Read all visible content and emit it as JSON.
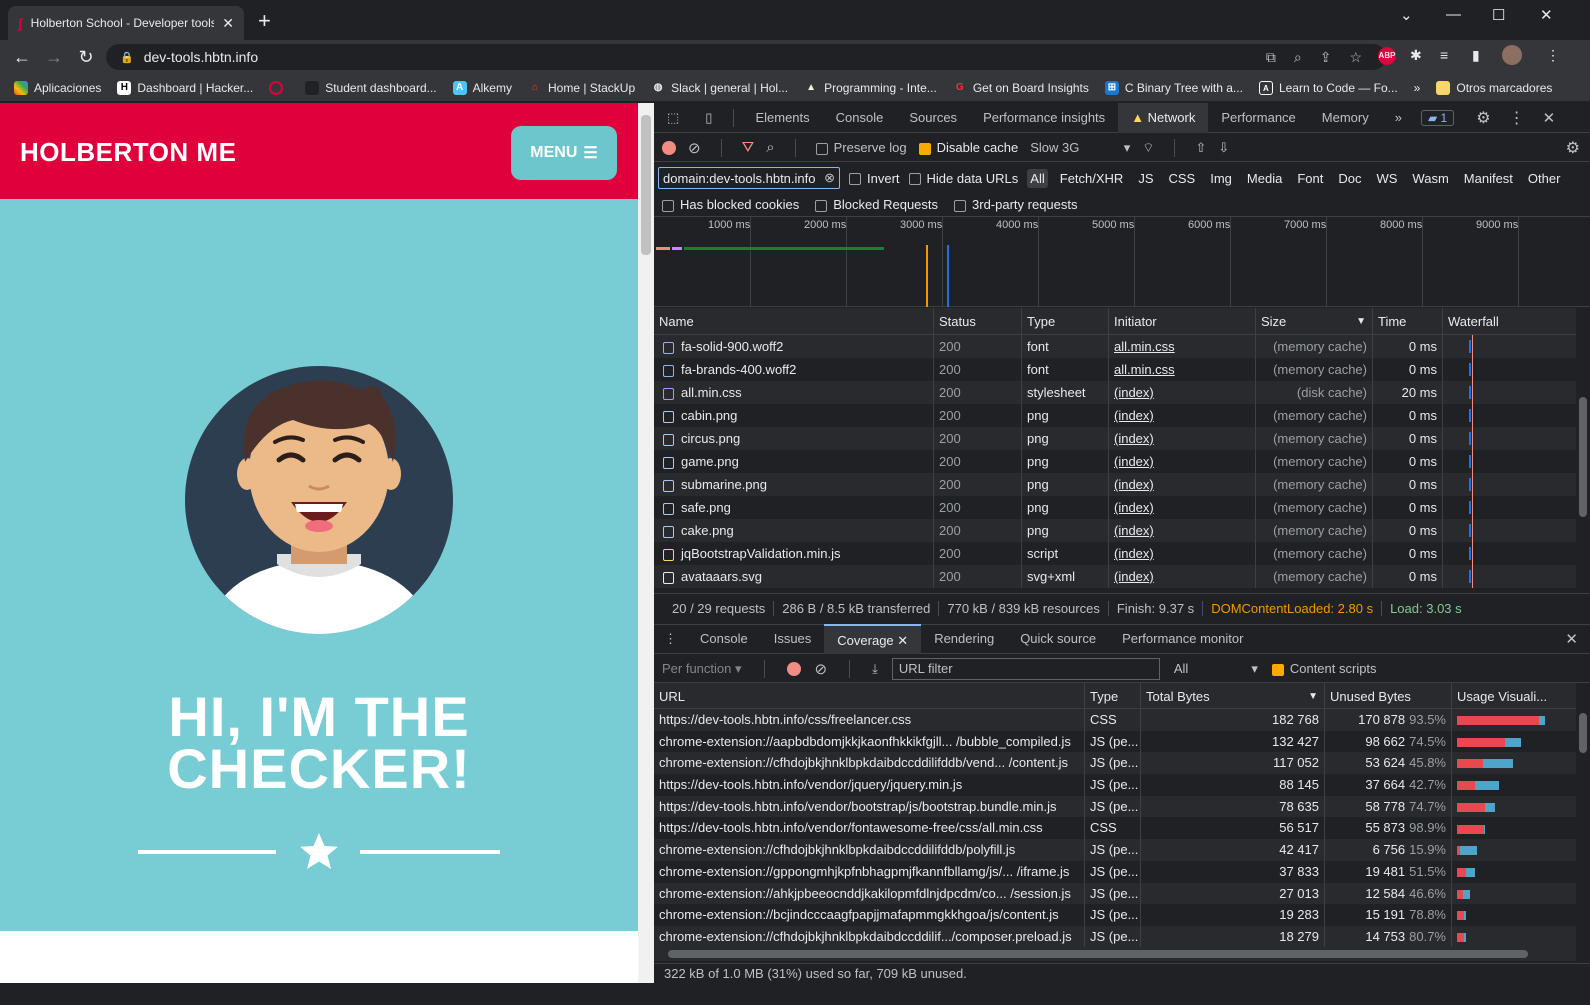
{
  "browser": {
    "tab_title": "Holberton School - Developer tools",
    "url": "dev-tools.hbtn.info",
    "bookmarks": [
      "Aplicaciones",
      "Dashboard | Hacker...",
      "",
      "Student dashboard...",
      "Alkemy",
      "Home | StackUp",
      "Slack | general | Hol...",
      "Programming - Inte...",
      "Get on Board Insights",
      "C Binary Tree with a...",
      "Learn to Code — Fo...",
      "»",
      "Otros marcadores"
    ]
  },
  "page": {
    "brand": "HOLBERTON ME",
    "menu_label": "MENU",
    "hero_line1": "HI, I'M THE",
    "hero_line2": "CHECKER!"
  },
  "devtools": {
    "tabs": [
      "Elements",
      "Console",
      "Sources",
      "Performance insights",
      "Network",
      "Performance",
      "Memory",
      "»"
    ],
    "issues_count": "1",
    "preserve_log": "Preserve log",
    "disable_cache": "Disable cache",
    "throttle": "Slow 3G",
    "filter_value": "domain:dev-tools.hbtn.info",
    "invert": "Invert",
    "hide_data_urls": "Hide data URLs",
    "type_filters": [
      "All",
      "Fetch/XHR",
      "JS",
      "CSS",
      "Img",
      "Media",
      "Font",
      "Doc",
      "WS",
      "Wasm",
      "Manifest",
      "Other"
    ],
    "has_blocked_cookies": "Has blocked cookies",
    "blocked_requests": "Blocked Requests",
    "third_party": "3rd-party requests",
    "timeline_ticks": [
      "1000 ms",
      "2000 ms",
      "3000 ms",
      "4000 ms",
      "5000 ms",
      "6000 ms",
      "7000 ms",
      "8000 ms",
      "9000 ms"
    ],
    "columns": [
      "Name",
      "Status",
      "Type",
      "Initiator",
      "Size",
      "Time",
      "Waterfall"
    ],
    "requests": [
      {
        "name": "fa-solid-900.woff2",
        "status": "200",
        "type": "font",
        "initiator": "all.min.css",
        "size": "(memory cache)",
        "time": "0 ms"
      },
      {
        "name": "fa-brands-400.woff2",
        "status": "200",
        "type": "font",
        "initiator": "all.min.css",
        "size": "(memory cache)",
        "time": "0 ms"
      },
      {
        "name": "all.min.css",
        "status": "200",
        "type": "stylesheet",
        "initiator": "(index)",
        "size": "(disk cache)",
        "time": "20 ms"
      },
      {
        "name": "cabin.png",
        "status": "200",
        "type": "png",
        "initiator": "(index)",
        "size": "(memory cache)",
        "time": "0 ms"
      },
      {
        "name": "circus.png",
        "status": "200",
        "type": "png",
        "initiator": "(index)",
        "size": "(memory cache)",
        "time": "0 ms"
      },
      {
        "name": "game.png",
        "status": "200",
        "type": "png",
        "initiator": "(index)",
        "size": "(memory cache)",
        "time": "0 ms"
      },
      {
        "name": "submarine.png",
        "status": "200",
        "type": "png",
        "initiator": "(index)",
        "size": "(memory cache)",
        "time": "0 ms"
      },
      {
        "name": "safe.png",
        "status": "200",
        "type": "png",
        "initiator": "(index)",
        "size": "(memory cache)",
        "time": "0 ms"
      },
      {
        "name": "cake.png",
        "status": "200",
        "type": "png",
        "initiator": "(index)",
        "size": "(memory cache)",
        "time": "0 ms"
      },
      {
        "name": "jqBootstrapValidation.min.js",
        "status": "200",
        "type": "script",
        "initiator": "(index)",
        "size": "(memory cache)",
        "time": "0 ms"
      },
      {
        "name": "avataaars.svg",
        "status": "200",
        "type": "svg+xml",
        "initiator": "(index)",
        "size": "(memory cache)",
        "time": "0 ms"
      }
    ],
    "status": {
      "requests": "20 / 29 requests",
      "transferred": "286 B / 8.5 kB transferred",
      "resources": "770 kB / 839 kB resources",
      "finish": "Finish: 9.37 s",
      "dcl": "DOMContentLoaded: 2.80 s",
      "load": "Load: 3.03 s"
    },
    "drawer_tabs": [
      "Console",
      "Issues",
      "Coverage",
      "Rendering",
      "Quick source",
      "Performance monitor"
    ],
    "coverage": {
      "per_function": "Per function",
      "url_filter_placeholder": "URL filter",
      "type_select": "All",
      "content_scripts": "Content scripts",
      "columns": [
        "URL",
        "Type",
        "Total Bytes",
        "Unused Bytes",
        "Usage Visuali..."
      ],
      "rows": [
        {
          "url": "https://dev-tools.hbtn.info/css/freelancer.css",
          "type": "CSS",
          "total": "182 768",
          "unused": "170 878",
          "pct": "93.5%",
          "used_frac": 0.065,
          "size_frac": 1.0
        },
        {
          "url": "chrome-extension://aapbdbdomjkkjkaonfhkkikfgjll... /bubble_compiled.js",
          "type": "JS (pe...",
          "total": "132 427",
          "unused": "98 662",
          "pct": "74.5%",
          "used_frac": 0.255,
          "size_frac": 0.725
        },
        {
          "url": "chrome-extension://cfhdojbkjhnklbpkdaibdccddilifddb/vend... /content.js",
          "type": "JS (pe...",
          "total": "117 052",
          "unused": "53 624",
          "pct": "45.8%",
          "used_frac": 0.542,
          "size_frac": 0.64
        },
        {
          "url": "https://dev-tools.hbtn.info/vendor/jquery/jquery.min.js",
          "type": "JS (pe...",
          "total": "88 145",
          "unused": "37 664",
          "pct": "42.7%",
          "used_frac": 0.573,
          "size_frac": 0.482
        },
        {
          "url": "https://dev-tools.hbtn.info/vendor/bootstrap/js/bootstrap.bundle.min.js",
          "type": "JS (pe...",
          "total": "78 635",
          "unused": "58 778",
          "pct": "74.7%",
          "used_frac": 0.253,
          "size_frac": 0.43
        },
        {
          "url": "https://dev-tools.hbtn.info/vendor/fontawesome-free/css/all.min.css",
          "type": "CSS",
          "total": "56 517",
          "unused": "55 873",
          "pct": "98.9%",
          "used_frac": 0.011,
          "size_frac": 0.309
        },
        {
          "url": "chrome-extension://cfhdojbkjhnklbpkdaibdccddilifddb/polyfill.js",
          "type": "JS (pe...",
          "total": "42 417",
          "unused": "6 756",
          "pct": "15.9%",
          "used_frac": 0.841,
          "size_frac": 0.232
        },
        {
          "url": "chrome-extension://gppongmhjkpfnbhagpmjfkannfbllamg/js/... /iframe.js",
          "type": "JS (pe...",
          "total": "37 833",
          "unused": "19 481",
          "pct": "51.5%",
          "used_frac": 0.485,
          "size_frac": 0.207
        },
        {
          "url": "chrome-extension://ahkjpbeeocnddjkakilopmfdlnjdpcdm/co... /session.js",
          "type": "JS (pe...",
          "total": "27 013",
          "unused": "12 584",
          "pct": "46.6%",
          "used_frac": 0.534,
          "size_frac": 0.148
        },
        {
          "url": "chrome-extension://bcjindcccaagfpapjjmafapmmgkkhgoa/js/content.js",
          "type": "JS (pe...",
          "total": "19 283",
          "unused": "15 191",
          "pct": "78.8%",
          "used_frac": 0.212,
          "size_frac": 0.105
        },
        {
          "url": "chrome-extension://cfhdojbkjhnklbpkdaibdccddilif.../composer.preload.js",
          "type": "JS (pe...",
          "total": "18 279",
          "unused": "14 753",
          "pct": "80.7%",
          "used_frac": 0.193,
          "size_frac": 0.1
        }
      ],
      "summary": "322 kB of 1.0 MB (31%) used so far, 709 kB unused."
    }
  },
  "colors": {
    "brand_red": "#e0003c",
    "hero_teal": "#78ccd4",
    "unused_red": "#e8484f",
    "used_blue": "#4ea4c9"
  }
}
